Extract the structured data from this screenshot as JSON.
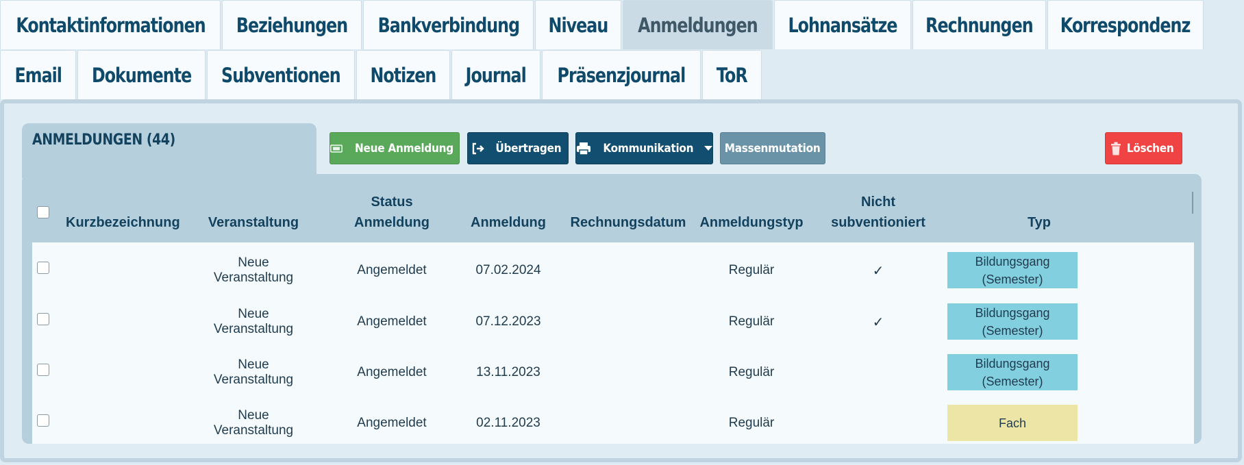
{
  "tabs_row1": [
    {
      "label": "Kontaktinformationen",
      "w": 322
    },
    {
      "label": "Beziehungen",
      "w": 204
    },
    {
      "label": "Bankverbindung",
      "w": 249
    },
    {
      "label": "Niveau",
      "w": 126
    },
    {
      "label": "Anmeldungen",
      "w": 219,
      "active": true
    },
    {
      "label": "Lohnansätze",
      "w": 200
    },
    {
      "label": "Rechnungen",
      "w": 195
    },
    {
      "label": "Korrespondenz",
      "w": 228
    }
  ],
  "tabs_row2": [
    {
      "label": "Email",
      "w": 111
    },
    {
      "label": "Dokumente",
      "w": 187
    },
    {
      "label": "Subventionen",
      "w": 216
    },
    {
      "label": "Notizen",
      "w": 137
    },
    {
      "label": "Journal",
      "w": 130
    },
    {
      "label": "Präsenzjournal",
      "w": 232
    },
    {
      "label": "ToR",
      "w": 87
    }
  ],
  "section": {
    "title": "ANMELDUNGEN (44)"
  },
  "toolbar": {
    "new_label": "Neue Anmeldung",
    "transfer_label": "Übertragen",
    "communication_label": "Kommunikation",
    "mass_label": "Massenmutation",
    "delete_label": "Löschen"
  },
  "table": {
    "headers": {
      "kurz": "Kurzbezeichnung",
      "veranstaltung": "Veranstaltung",
      "status_l1": "Status",
      "status_l2": "Anmeldung",
      "anmeldung": "Anmeldung",
      "rechnungsdatum": "Rechnungsdatum",
      "anmeldungstyp": "Anmeldungstyp",
      "nicht_l1": "Nicht",
      "nicht_l2": "subventioniert",
      "typ": "Typ"
    },
    "rows": [
      {
        "kurz": "",
        "veranstaltung": "Neue Veranstaltung",
        "status": "Angemeldet",
        "anmeldung": "07.02.2024",
        "rechnungsdatum": "",
        "anmeldungstyp": "Regulär",
        "nicht_subventioniert": "✓",
        "typ_l1": "Bildungsgang",
        "typ_l2": "(Semester)",
        "typ_color": "blue"
      },
      {
        "kurz": "",
        "veranstaltung": "Neue Veranstaltung",
        "status": "Angemeldet",
        "anmeldung": "07.12.2023",
        "rechnungsdatum": "",
        "anmeldungstyp": "Regulär",
        "nicht_subventioniert": "✓",
        "typ_l1": "Bildungsgang",
        "typ_l2": "(Semester)",
        "typ_color": "blue"
      },
      {
        "kurz": "",
        "veranstaltung": "Neue Veranstaltung",
        "status": "Angemeldet",
        "anmeldung": "13.11.2023",
        "rechnungsdatum": "",
        "anmeldungstyp": "Regulär",
        "nicht_subventioniert": "",
        "typ_l1": "Bildungsgang",
        "typ_l2": "(Semester)",
        "typ_color": "blue"
      },
      {
        "kurz": "",
        "veranstaltung": "Neue Veranstaltung",
        "status": "Angemeldet",
        "anmeldung": "02.11.2023",
        "rechnungsdatum": "",
        "anmeldungstyp": "Regulär",
        "nicht_subventioniert": "",
        "typ_l1": "Fach",
        "typ_l2": "",
        "typ_color": "yellow"
      }
    ]
  },
  "colors": {
    "tab_text": "#0f4a6b",
    "btn_green": "#5aa85a",
    "btn_dark": "#114e6f",
    "btn_gray": "#6b93a8",
    "btn_red": "#ef4443",
    "badge_blue": "#82cfe0",
    "badge_yellow": "#ece5a6"
  }
}
